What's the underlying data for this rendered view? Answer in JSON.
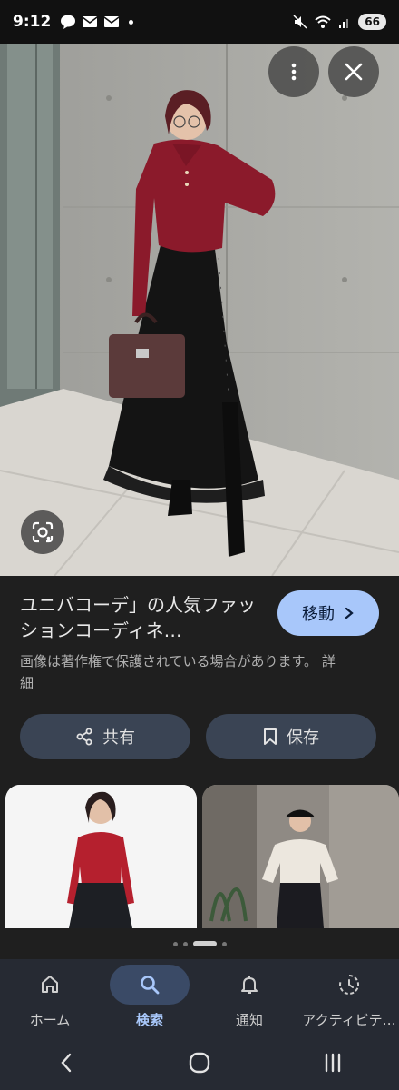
{
  "status": {
    "time": "9:12",
    "battery": "66",
    "left_icons": [
      "line-icon",
      "mail-icon",
      "mail-icon"
    ]
  },
  "hero": {
    "more_icon": "more-vert-icon",
    "close_icon": "close-icon",
    "lens_icon": "lens-icon"
  },
  "result": {
    "title": "ユニバコーデ」の人気ファッションコーディネ…",
    "goto_label": "移動",
    "copyright": "画像は著作権で保護されている場合があります。 詳細",
    "share_label": "共有",
    "save_label": "保存"
  },
  "pager": {
    "count": 4,
    "active": 2
  },
  "bottom_nav": [
    {
      "label": "ホーム",
      "icon": "home-icon",
      "active": false
    },
    {
      "label": "検索",
      "icon": "search-icon",
      "active": true
    },
    {
      "label": "通知",
      "icon": "bell-icon",
      "active": false
    },
    {
      "label": "アクティビテ…",
      "icon": "activity-icon",
      "active": false
    }
  ],
  "colors": {
    "accent": "#a8c7fa",
    "background": "#1f1f1f",
    "sweater": "#8b1a2b",
    "skirt": "#111111"
  }
}
